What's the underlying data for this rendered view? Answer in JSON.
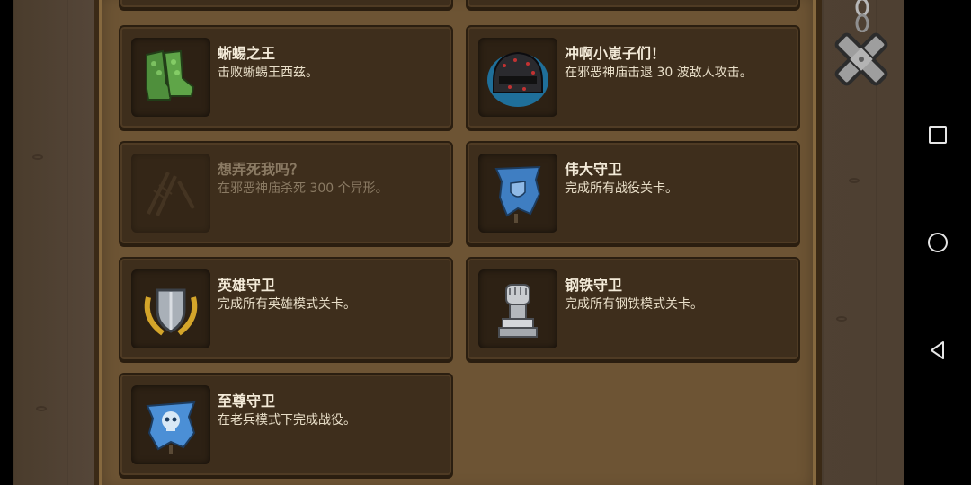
{
  "achievements": [
    {
      "title": "蜥蜴之王",
      "desc": "击败蜥蜴王西兹。",
      "icon": "green-boots-icon",
      "locked": false
    },
    {
      "title": "冲啊小崽子们！",
      "desc": "在邪恶神庙击退 30 波敌人攻击。",
      "icon": "dark-helmet-icon",
      "locked": false
    },
    {
      "title": "想弄死我吗？",
      "desc": "在邪恶神庙杀死 300 个异形。",
      "icon": "locked-scratch-icon",
      "locked": true
    },
    {
      "title": "伟大守卫",
      "desc": "完成所有战役关卡。",
      "icon": "blue-banner-icon",
      "locked": false
    },
    {
      "title": "英雄守卫",
      "desc": "完成所有英雄模式关卡。",
      "icon": "laurel-shield-icon",
      "locked": false
    },
    {
      "title": "钢铁守卫",
      "desc": "完成所有钢铁模式关卡。",
      "icon": "iron-fist-icon",
      "locked": false
    },
    {
      "title": "至尊守卫",
      "desc": "在老兵模式下完成战役。",
      "icon": "skull-banner-icon",
      "locked": false
    }
  ],
  "close_button": {
    "icon": "close-x-icon"
  },
  "nav": {
    "icons": [
      "recent-apps-icon",
      "home-icon",
      "back-icon"
    ]
  },
  "colors": {
    "panel": "#6d5434",
    "card": "#3e2e1c",
    "title_text": "#f3ead8",
    "locked_text": "#8a7a63"
  }
}
